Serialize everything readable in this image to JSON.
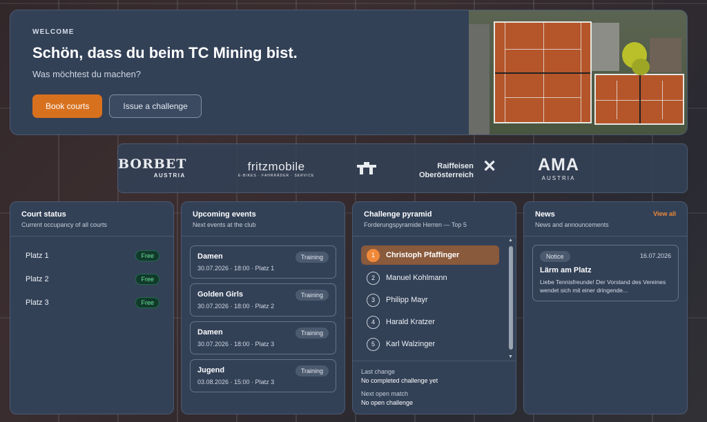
{
  "hero": {
    "eyebrow": "WELCOME",
    "title": "Schön, dass du beim TC Mining bist.",
    "subtitle": "Was möchtest du machen?",
    "primary_button": "Book courts",
    "secondary_button": "Issue a challenge"
  },
  "sponsors": {
    "borbet": "BORBET",
    "borbet_sub": "AUSTRIA",
    "fritz": "fritzmobile",
    "fritz_sub": "E-BIKES · FAHRRÄDER · SERVICE",
    "raiffeisen_line1": "Raiffeisen",
    "raiffeisen_line2": "Oberösterreich",
    "ama": "AMA",
    "ama_sub": "AUSTRIA"
  },
  "court_status": {
    "title": "Court status",
    "subtitle": "Current occupancy of all courts",
    "courts": [
      {
        "name": "Platz 1",
        "status": "Free"
      },
      {
        "name": "Platz 2",
        "status": "Free"
      },
      {
        "name": "Platz 3",
        "status": "Free"
      }
    ]
  },
  "events": {
    "title": "Upcoming events",
    "subtitle": "Next events at the club",
    "items": [
      {
        "name": "Damen",
        "meta": "30.07.2026 · 18:00 · Platz 1",
        "tag": "Training"
      },
      {
        "name": "Golden Girls",
        "meta": "30.07.2026 · 18:00 · Platz 2",
        "tag": "Training"
      },
      {
        "name": "Damen",
        "meta": "30.07.2026 · 18:00 · Platz 3",
        "tag": "Training"
      },
      {
        "name": "Jugend",
        "meta": "03.08.2026 · 15:00 · Platz 3",
        "tag": "Training"
      }
    ]
  },
  "pyramid": {
    "title": "Challenge pyramid",
    "subtitle": "Forderungspyramide Herren — Top 5",
    "players": [
      {
        "rank": "1",
        "name": "Christoph Pfaffinger"
      },
      {
        "rank": "2",
        "name": "Manuel Kohlmann"
      },
      {
        "rank": "3",
        "name": "Philipp Mayr"
      },
      {
        "rank": "4",
        "name": "Harald Kratzer"
      },
      {
        "rank": "5",
        "name": "Karl Walzinger"
      }
    ],
    "last_change_label": "Last change",
    "last_change_value": "No completed challenge yet",
    "next_match_label": "Next open match",
    "next_match_value": "No open challenge"
  },
  "news": {
    "title": "News",
    "subtitle": "News and announcements",
    "view_all": "View all",
    "item": {
      "tag": "Notice",
      "date": "16.07.2026",
      "title": "Lärm am Platz",
      "body": "Liebe Tennisfreunde! Der Vorstand des Vereines wendet sich mit einer dringende..."
    }
  },
  "colors": {
    "accent": "#d8711e",
    "card": "#334157",
    "free": "#6ee39b"
  }
}
